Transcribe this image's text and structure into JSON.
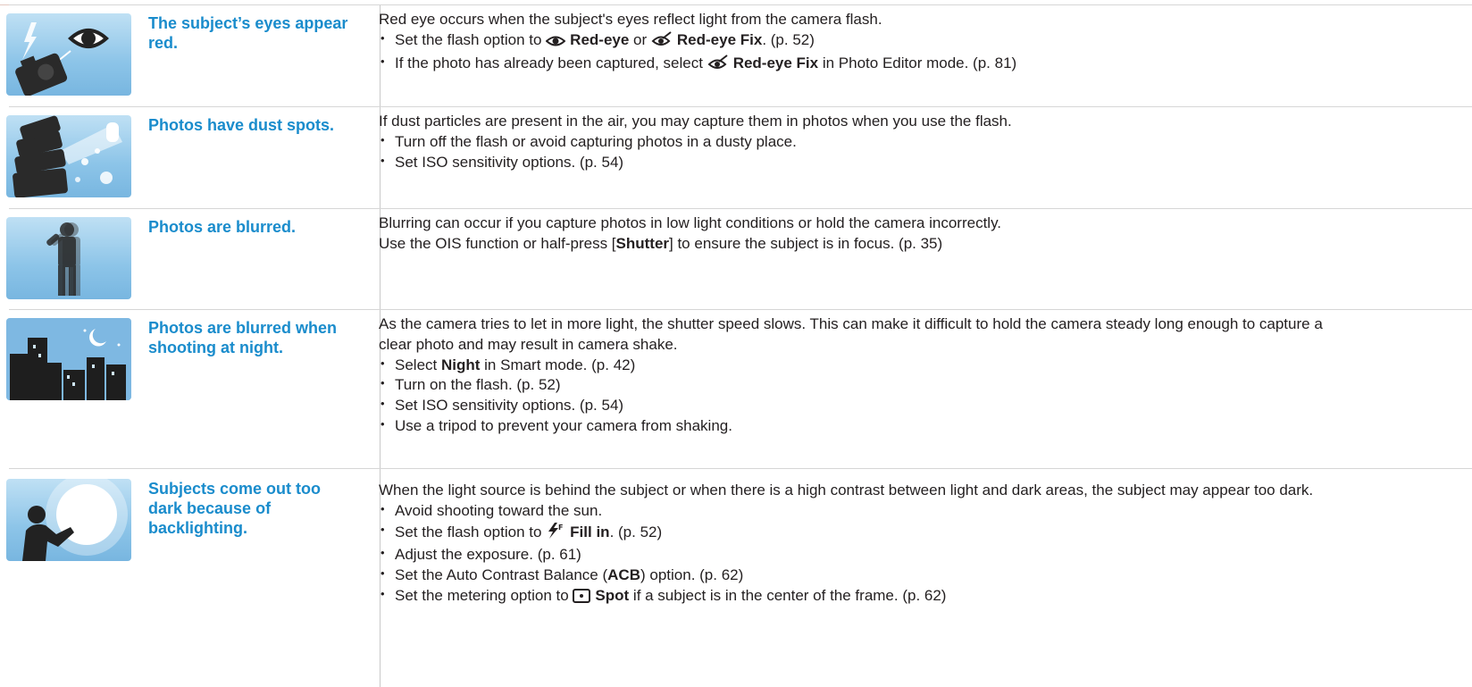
{
  "rows": [
    {
      "title": "The subject’s eyes appear red.",
      "thumb_icon": "red-eye-illustration",
      "intro": [
        "Red eye occurs when the subject's eyes reflect light from the camera flash."
      ],
      "bullets": [
        {
          "pre": "Set the flash option to ",
          "icon1": "eye-icon",
          "b1": "Red-eye",
          "mid": " or ",
          "icon2": "red-eye-fix-icon",
          "b2": "Red-eye Fix",
          "post": ". (p. 52)"
        },
        {
          "pre": "If the photo has already been captured, select ",
          "icon1": "red-eye-fix-icon",
          "b1": "Red-eye Fix",
          "post": " in Photo Editor mode. (p. 81)"
        }
      ]
    },
    {
      "title": "Photos have dust spots.",
      "thumb_icon": "dust-spots-illustration",
      "intro": [
        "If dust particles are present in the air, you may capture them in photos when you use the flash."
      ],
      "bullets": [
        {
          "pre": "Turn off the flash or avoid capturing photos in a dusty place."
        },
        {
          "pre": "Set ISO sensitivity options. (p. 54)"
        }
      ]
    },
    {
      "title": "Photos are blurred.",
      "thumb_icon": "blurred-person-illustration",
      "intro": [
        "Blurring can occur if you capture photos in low light conditions or hold the camera incorrectly.",
        {
          "pre": "Use the OIS function or half-press [",
          "b1": "Shutter",
          "post": "] to ensure the subject is in focus. (p. 35)"
        }
      ],
      "bullets": []
    },
    {
      "title": "Photos are blurred when shooting at night.",
      "thumb_icon": "night-city-illustration",
      "intro": [
        "As the camera tries to let in more light, the shutter speed slows. This can make it difficult to hold the camera steady long enough to capture a clear photo and may result in camera shake."
      ],
      "bullets": [
        {
          "pre": "Select ",
          "b1": "Night",
          "post": " in Smart mode. (p. 42)"
        },
        {
          "pre": "Turn on the flash. (p. 52)"
        },
        {
          "pre": "Set ISO sensitivity options. (p. 54)"
        },
        {
          "pre": "Use a tripod to prevent your camera from shaking."
        }
      ]
    },
    {
      "title": "Subjects come out too dark because of backlighting.",
      "thumb_icon": "backlight-illustration",
      "intro": [
        "When the light source is behind the subject or when there is a high contrast between light and dark areas, the subject may appear too dark."
      ],
      "bullets": [
        {
          "pre": "Avoid shooting toward the sun."
        },
        {
          "pre": "Set the flash option to ",
          "icon1": "fill-in-flash-icon",
          "b1": "Fill in",
          "post": ". (p. 52)"
        },
        {
          "pre": "Adjust the exposure. (p. 61)"
        },
        {
          "pre": "Set the Auto Contrast Balance (",
          "b1": "ACB",
          "post": ") option. (p. 62)"
        },
        {
          "pre": "Set the metering option to ",
          "icon1": "spot-metering-icon",
          "b1": "Spot",
          "post": " if a subject is in the center of the frame. (p. 62)"
        }
      ]
    }
  ]
}
